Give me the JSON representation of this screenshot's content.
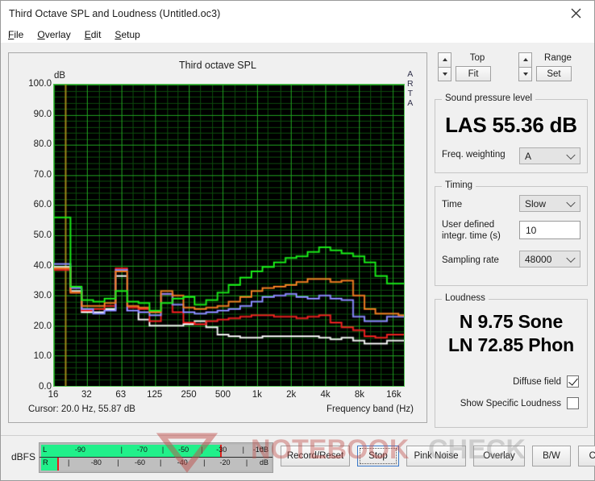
{
  "window": {
    "title": "Third Octave SPL and Loudness (Untitled.oc3)",
    "close_icon": "close-icon"
  },
  "menu": [
    {
      "label": "File",
      "accel": "F"
    },
    {
      "label": "Overlay",
      "accel": "O"
    },
    {
      "label": "Edit",
      "accel": "E"
    },
    {
      "label": "Setup",
      "accel": "S"
    }
  ],
  "toolbar_top": {
    "top_label": "Top",
    "top_action": "Fit",
    "range_label": "Range",
    "range_action": "Set"
  },
  "spl": {
    "group_title": "Sound pressure level",
    "readout": "LAS 55.36 dB",
    "weighting_label": "Freq. weighting",
    "weighting_value": "A"
  },
  "timing": {
    "group_title": "Timing",
    "time_label": "Time",
    "time_value": "Slow",
    "integr_label_line1": "User defined",
    "integr_label_line2": "integr. time (s)",
    "integr_value": "10",
    "sampling_label": "Sampling rate",
    "sampling_value": "48000"
  },
  "loudness": {
    "group_title": "Loudness",
    "sone": "N 9.75 Sone",
    "phon": "LN 72.85 Phon",
    "diffuse_label": "Diffuse field",
    "diffuse_checked": true,
    "specific_label": "Show Specific Loudness",
    "specific_checked": false
  },
  "meter": {
    "unit_label": "dBFS",
    "left_channel": "L",
    "right_channel": "R",
    "db_label": "dB",
    "top_ticks": [
      "-90",
      "-70",
      "-50",
      "-30",
      "-10"
    ],
    "bottom_ticks": [
      "-80",
      "-60",
      "-40",
      "-20"
    ],
    "left_fill_pct": 78,
    "right_fill_pct": 7
  },
  "buttons": [
    {
      "label": "Record/Reset",
      "focused": false
    },
    {
      "label": "Stop",
      "focused": true
    },
    {
      "label": "Pink Noise",
      "focused": false
    },
    {
      "label": "Overlay",
      "focused": false
    },
    {
      "label": "B/W",
      "focused": false
    },
    {
      "label": "Copy",
      "focused": false
    }
  ],
  "chart_meta": {
    "arta_watermark": "ARTA",
    "y_unit": "dB",
    "cursor_text": "Cursor:   20.0 Hz, 55.87 dB",
    "xaxis_label": "Frequency band (Hz)"
  },
  "chart_data": {
    "type": "line",
    "title": "Third octave SPL",
    "xlabel": "Frequency band (Hz)",
    "ylabel": "dB",
    "ylim": [
      0,
      100
    ],
    "ytick_step": 10,
    "yticks": [
      "0.0",
      "10.0",
      "20.0",
      "30.0",
      "40.0",
      "50.0",
      "60.0",
      "70.0",
      "80.0",
      "90.0",
      "100.0"
    ],
    "grid": true,
    "x_is_log": true,
    "bands": [
      16,
      20,
      25,
      31.5,
      40,
      50,
      63,
      80,
      100,
      125,
      160,
      200,
      250,
      315,
      400,
      500,
      630,
      800,
      1000,
      1250,
      1600,
      2000,
      2500,
      3150,
      4000,
      5000,
      6300,
      8000,
      10000,
      12500,
      16000,
      20000
    ],
    "xtick_labels": [
      "16",
      "32",
      "63",
      "125",
      "250",
      "500",
      "1k",
      "2k",
      "4k",
      "8k",
      "16k"
    ],
    "xtick_bands": [
      16,
      31.5,
      63,
      125,
      250,
      500,
      1000,
      2000,
      4000,
      8000,
      16000
    ],
    "cursor_band_hz": 20.0,
    "cursor_value_db": 55.87,
    "series": [
      {
        "name": "green",
        "color": "#18e818",
        "values": [
          55.9,
          55.9,
          33.0,
          28.5,
          28.0,
          29.0,
          31.5,
          28.0,
          27.5,
          25.0,
          27.5,
          29.0,
          29.5,
          27.0,
          28.5,
          31.0,
          33.5,
          36.0,
          38.0,
          39.5,
          41.0,
          42.5,
          43.0,
          44.5,
          46.0,
          45.0,
          44.0,
          43.0,
          41.0,
          36.5,
          34.0,
          34.0
        ]
      },
      {
        "name": "orange",
        "color": "#ef7c22",
        "values": [
          39.0,
          39.0,
          31.0,
          26.5,
          26.5,
          27.5,
          38.0,
          26.5,
          26.0,
          24.5,
          31.5,
          30.0,
          26.0,
          25.5,
          26.0,
          26.5,
          28.0,
          29.5,
          31.5,
          32.5,
          33.0,
          33.5,
          34.5,
          35.5,
          35.5,
          34.5,
          35.0,
          30.0,
          25.5,
          24.0,
          24.0,
          23.5
        ]
      },
      {
        "name": "blue",
        "color": "#8a8aff",
        "values": [
          40.5,
          40.5,
          32.5,
          25.5,
          24.0,
          25.0,
          38.5,
          25.0,
          24.5,
          23.5,
          30.5,
          27.0,
          24.5,
          24.0,
          24.5,
          25.0,
          25.5,
          26.5,
          28.0,
          29.5,
          30.0,
          30.5,
          29.5,
          29.0,
          30.0,
          29.0,
          28.5,
          23.0,
          21.5,
          21.5,
          23.0,
          23.0
        ]
      },
      {
        "name": "red",
        "color": "#ee2020",
        "values": [
          38.5,
          38.5,
          31.0,
          25.0,
          25.5,
          26.5,
          39.0,
          26.0,
          25.5,
          21.5,
          30.5,
          24.5,
          21.0,
          20.5,
          21.5,
          22.0,
          22.5,
          23.0,
          23.5,
          23.5,
          23.0,
          23.0,
          22.5,
          23.0,
          23.5,
          21.0,
          19.5,
          18.5,
          16.5,
          16.0,
          17.0,
          17.0
        ]
      },
      {
        "name": "white",
        "color": "#f2f2f2",
        "values": [
          39.5,
          39.5,
          31.5,
          24.5,
          24.5,
          25.5,
          36.5,
          25.0,
          22.0,
          20.0,
          20.0,
          20.0,
          20.5,
          21.5,
          19.5,
          17.0,
          16.5,
          16.0,
          16.0,
          16.5,
          16.5,
          16.5,
          16.5,
          16.5,
          16.0,
          15.5,
          16.0,
          15.0,
          14.0,
          14.0,
          15.0,
          15.0
        ]
      }
    ]
  }
}
